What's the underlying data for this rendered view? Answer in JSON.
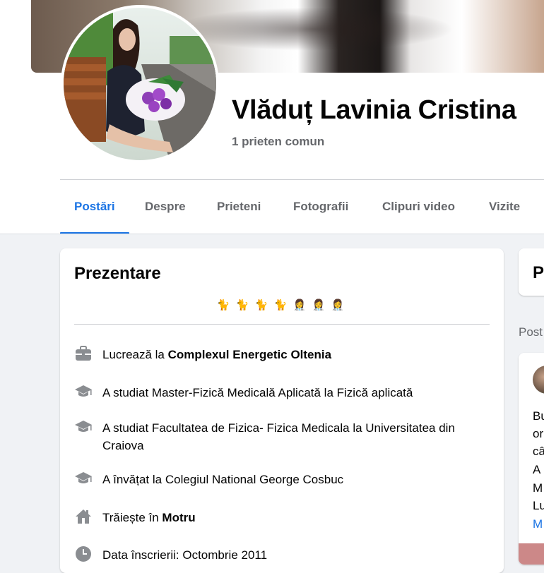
{
  "profile": {
    "name": "Vlăduț Lavinia Cristina",
    "mutual_friends": "1 prieten comun"
  },
  "tabs": [
    {
      "label": "Postări",
      "active": true
    },
    {
      "label": "Despre",
      "active": false
    },
    {
      "label": "Prieteni",
      "active": false
    },
    {
      "label": "Fotografii",
      "active": false
    },
    {
      "label": "Clipuri video",
      "active": false
    },
    {
      "label": "Vizite",
      "active": false
    }
  ],
  "intro": {
    "title": "Prezentare",
    "bio_emojis": [
      "🐈",
      "🐈",
      "🐈",
      "🐈",
      "👩‍⚕️",
      "👩‍⚕️",
      "👩‍⚕️"
    ],
    "items": [
      {
        "icon": "briefcase-icon",
        "prefix": "Lucrează la ",
        "bold": "Complexul Energetic Oltenia",
        "suffix": ""
      },
      {
        "icon": "graduation-cap-icon",
        "prefix": "A studiat Master-Fizică Medicală Aplicată la Fizică aplicată",
        "bold": "",
        "suffix": ""
      },
      {
        "icon": "graduation-cap-icon",
        "prefix": "A studiat Facultatea de Fizica- Fizica Medicala la Universitatea din Craiova",
        "bold": "",
        "suffix": ""
      },
      {
        "icon": "graduation-cap-icon",
        "prefix": "A învățat la Colegiul National George Cosbuc",
        "bold": "",
        "suffix": ""
      },
      {
        "icon": "home-icon",
        "prefix": "Trăiește în ",
        "bold": "Motru",
        "suffix": ""
      },
      {
        "icon": "clock-icon",
        "prefix": "Data înscrierii: Octombrie 2011",
        "bold": "",
        "suffix": ""
      }
    ]
  },
  "side": {
    "card_title": "P",
    "section_label": "Post",
    "post_lines": [
      "Bu",
      "or",
      "câ",
      " A",
      "M",
      "Lu"
    ],
    "post_more": "M"
  },
  "colors": {
    "accent": "#1b74e4",
    "secondary_text": "#65676b",
    "background": "#f0f2f5"
  }
}
